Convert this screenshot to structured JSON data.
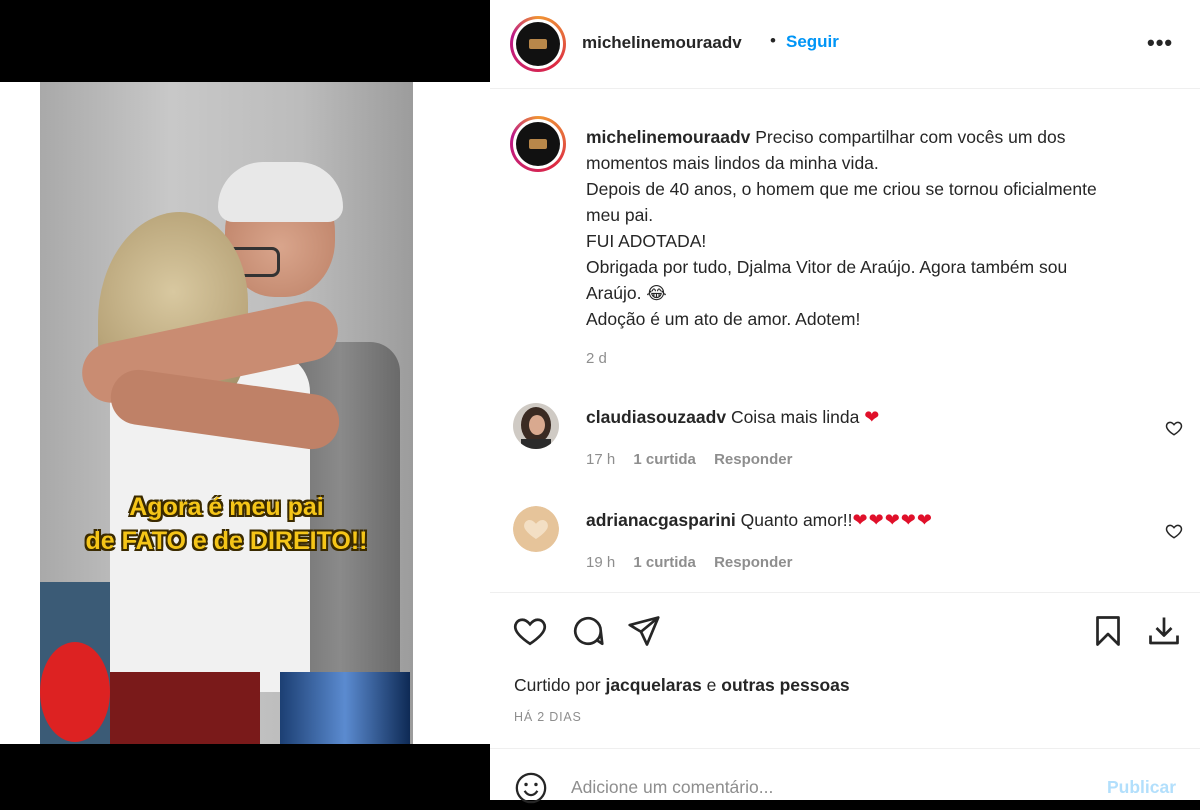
{
  "post": {
    "caption_overlay": [
      "Agora é meu pai",
      "de FATO e de DIREITO!!"
    ]
  },
  "header": {
    "username": "michelinemouraadv",
    "dot": "•",
    "follow_label": "Seguir",
    "more_label": "•••"
  },
  "caption": {
    "username": "michelinemouraadv",
    "lines": [
      "Preciso compartilhar com vocês um dos",
      "momentos mais lindos da minha vida.",
      "Depois de 40 anos, o homem que me criou se tornou oficialmente",
      "meu pai.",
      "FUI ADOTADA!",
      "Obrigada por tudo, Djalma Vitor de Araújo. Agora também sou",
      "Araújo. 😂",
      "Adoção é um ato de amor. Adotem!"
    ],
    "time": "2 d"
  },
  "comments": [
    {
      "username": "claudiasouzaadv",
      "text": "Coisa mais linda",
      "emoji": "❤",
      "time": "17 h",
      "likes": "1 curtida",
      "reply": "Responder"
    },
    {
      "username": "adrianacgasparini",
      "text": "Quanto amor!!",
      "emoji": "❤❤❤❤❤",
      "time": "19 h",
      "likes": "1 curtida",
      "reply": "Responder"
    }
  ],
  "likes": {
    "prefix": "Curtido por",
    "user": "jacquelaras",
    "middle": "e",
    "others": "outras pessoas"
  },
  "date": "HÁ 2 DIAS",
  "add_comment": {
    "placeholder": "Adicione um comentário...",
    "publish_label": "Publicar"
  },
  "colors": {
    "accent": "#0095f6",
    "publish_disabled": "#b2dffc",
    "heart_red": "#e0102a",
    "caption_yellow": "#f5c518"
  }
}
